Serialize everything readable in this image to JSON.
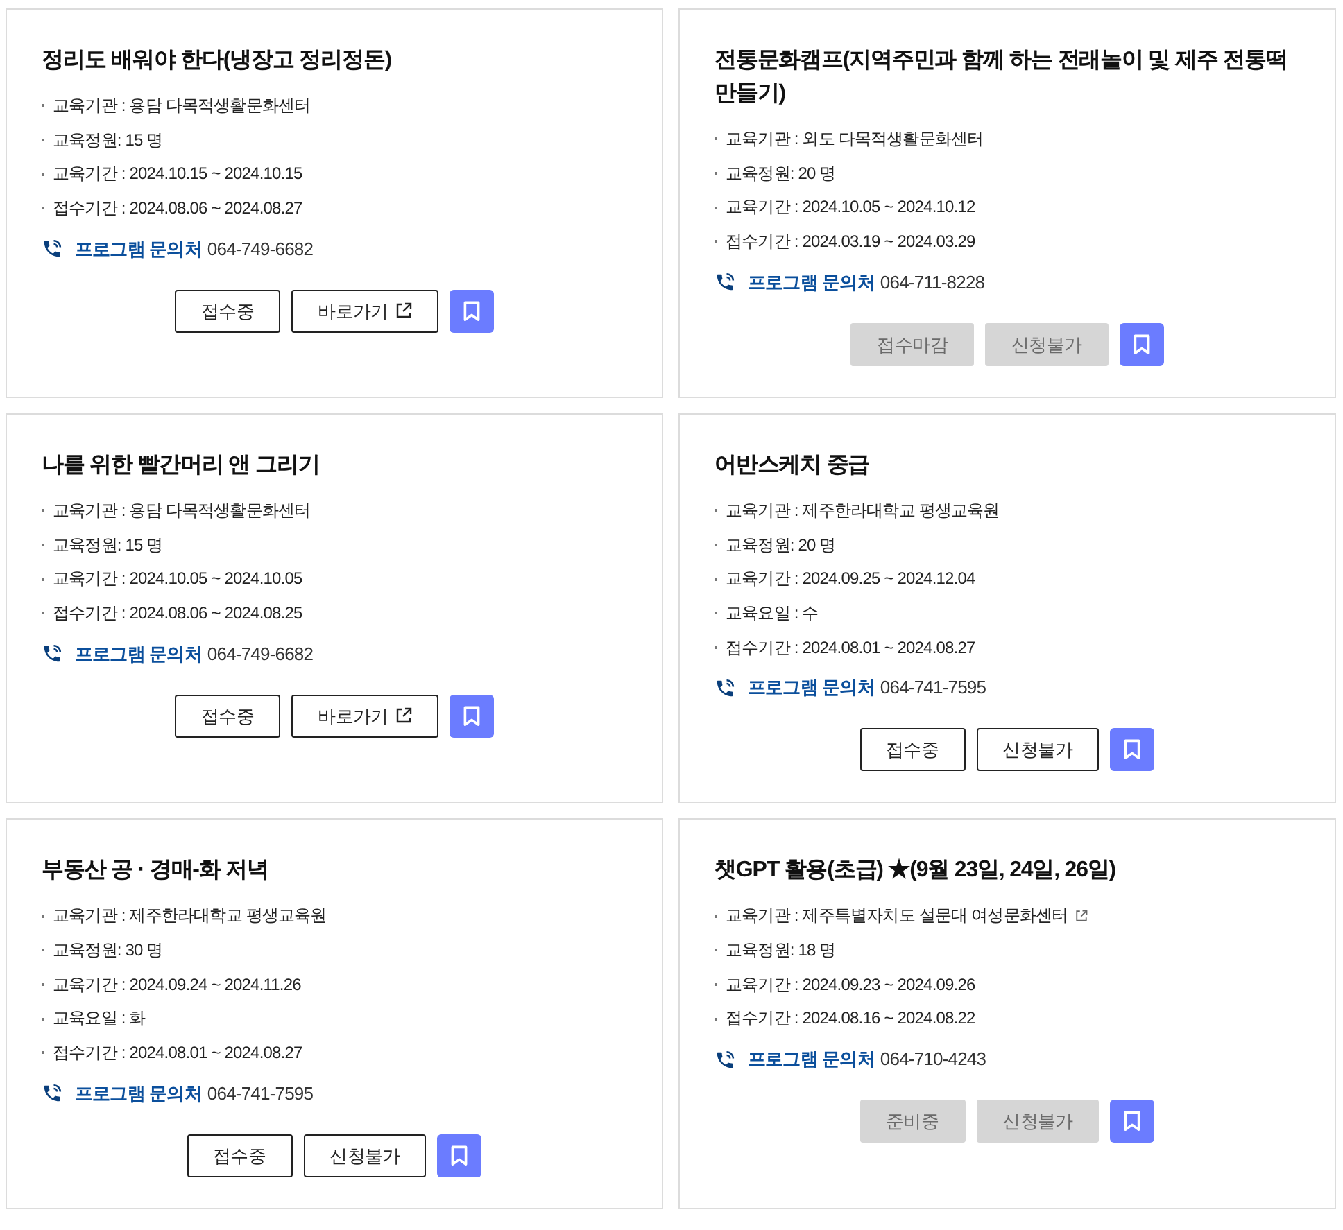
{
  "cards": [
    {
      "title": "정리도 배워야 한다(냉장고 정리정돈)",
      "info": [
        {
          "text": "교육기관 : 용담 다목적생활문화센터",
          "external": false
        },
        {
          "text": "교육정원: 15 명",
          "external": false
        },
        {
          "text": "교육기간 : 2024.10.15 ~ 2024.10.15",
          "external": false
        },
        {
          "text": "접수기간 : 2024.08.06 ~ 2024.08.27",
          "external": false
        }
      ],
      "contact": {
        "label": "프로그램 문의처",
        "phone": "064-749-6682"
      },
      "buttons": [
        {
          "label": "접수중",
          "kind": "status",
          "disabled": false
        },
        {
          "label": "바로가기",
          "kind": "link",
          "disabled": false
        }
      ]
    },
    {
      "title": "전통문화캠프(지역주민과 함께 하는 전래놀이 및 제주 전통떡 만들기)",
      "info": [
        {
          "text": "교육기관 : 외도 다목적생활문화센터",
          "external": false
        },
        {
          "text": "교육정원: 20 명",
          "external": false
        },
        {
          "text": "교육기간 : 2024.10.05 ~ 2024.10.12",
          "external": false
        },
        {
          "text": "접수기간 : 2024.03.19 ~ 2024.03.29",
          "external": false
        }
      ],
      "contact": {
        "label": "프로그램 문의처",
        "phone": "064-711-8228"
      },
      "buttons": [
        {
          "label": "접수마감",
          "kind": "status",
          "disabled": true
        },
        {
          "label": "신청불가",
          "kind": "apply",
          "disabled": true
        }
      ]
    },
    {
      "title": "나를 위한 빨간머리 앤 그리기",
      "info": [
        {
          "text": "교육기관 : 용담 다목적생활문화센터",
          "external": false
        },
        {
          "text": "교육정원: 15 명",
          "external": false
        },
        {
          "text": "교육기간 : 2024.10.05 ~ 2024.10.05",
          "external": false
        },
        {
          "text": "접수기간 : 2024.08.06 ~ 2024.08.25",
          "external": false
        }
      ],
      "contact": {
        "label": "프로그램 문의처",
        "phone": "064-749-6682"
      },
      "buttons": [
        {
          "label": "접수중",
          "kind": "status",
          "disabled": false
        },
        {
          "label": "바로가기",
          "kind": "link",
          "disabled": false
        }
      ]
    },
    {
      "title": "어반스케치 중급",
      "info": [
        {
          "text": "교육기관 : 제주한라대학교 평생교육원",
          "external": false
        },
        {
          "text": "교육정원: 20 명",
          "external": false
        },
        {
          "text": "교육기간 : 2024.09.25 ~ 2024.12.04",
          "external": false
        },
        {
          "text": "교육요일 : 수",
          "external": false
        },
        {
          "text": "접수기간 : 2024.08.01 ~ 2024.08.27",
          "external": false
        }
      ],
      "contact": {
        "label": "프로그램 문의처",
        "phone": "064-741-7595"
      },
      "buttons": [
        {
          "label": "접수중",
          "kind": "status",
          "disabled": false
        },
        {
          "label": "신청불가",
          "kind": "apply",
          "disabled": false
        }
      ]
    },
    {
      "title": "부동산 공 · 경매-화 저녁",
      "info": [
        {
          "text": "교육기관 : 제주한라대학교 평생교육원",
          "external": false
        },
        {
          "text": "교육정원: 30 명",
          "external": false
        },
        {
          "text": "교육기간 : 2024.09.24 ~ 2024.11.26",
          "external": false
        },
        {
          "text": "교육요일 : 화",
          "external": false
        },
        {
          "text": "접수기간 : 2024.08.01 ~ 2024.08.27",
          "external": false
        }
      ],
      "contact": {
        "label": "프로그램 문의처",
        "phone": "064-741-7595"
      },
      "buttons": [
        {
          "label": "접수중",
          "kind": "status",
          "disabled": false
        },
        {
          "label": "신청불가",
          "kind": "apply",
          "disabled": false
        }
      ]
    },
    {
      "title": "챗GPT 활용(초급) ★(9월 23일, 24일, 26일)",
      "info": [
        {
          "text": "교육기관 : 제주특별자치도 설문대 여성문화센터",
          "external": true
        },
        {
          "text": "교육정원: 18 명",
          "external": false
        },
        {
          "text": "교육기간 : 2024.09.23 ~ 2024.09.26",
          "external": false
        },
        {
          "text": "접수기간 : 2024.08.16 ~ 2024.08.22",
          "external": false
        }
      ],
      "contact": {
        "label": "프로그램 문의처",
        "phone": "064-710-4243"
      },
      "buttons": [
        {
          "label": "준비중",
          "kind": "status",
          "disabled": true
        },
        {
          "label": "신청불가",
          "kind": "apply",
          "disabled": true
        }
      ]
    }
  ]
}
